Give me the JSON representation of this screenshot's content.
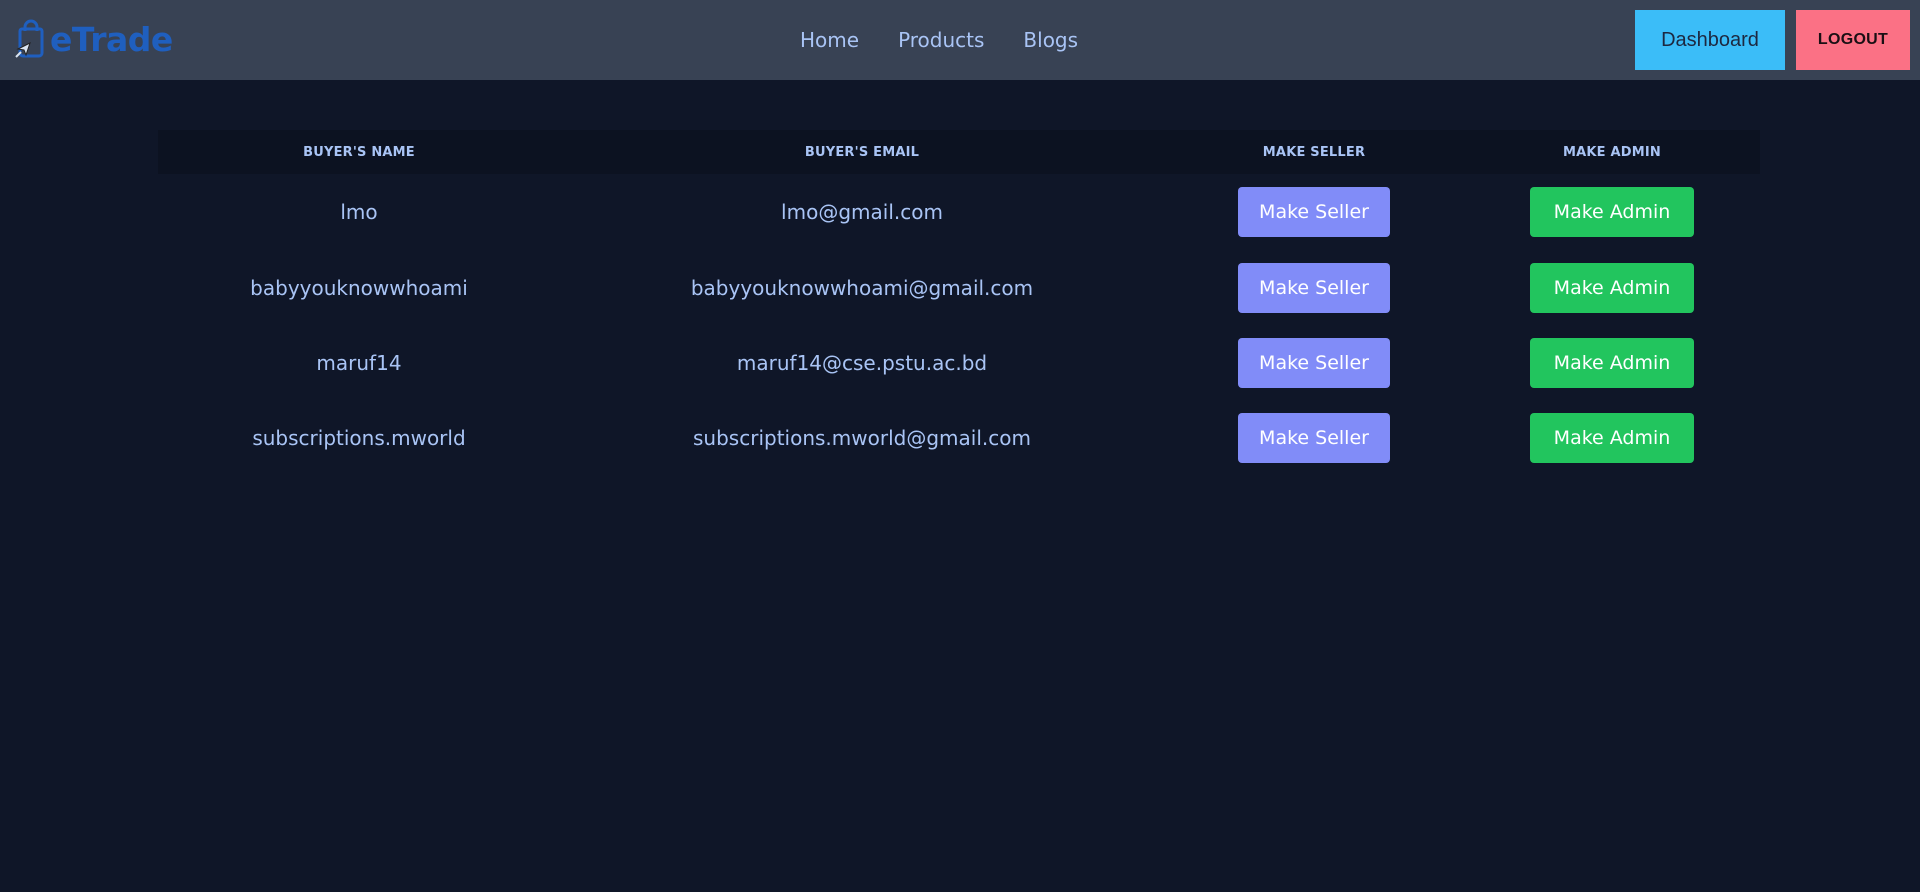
{
  "nav": {
    "brand": "eTrade",
    "links": [
      "Home",
      "Products",
      "Blogs"
    ],
    "dashboard_label": "Dashboard",
    "logout_label": "LOGOUT"
  },
  "table": {
    "headers": {
      "name": "BUYER'S NAME",
      "email": "BUYER'S EMAIL",
      "seller": "MAKE SELLER",
      "admin": "MAKE ADMIN"
    },
    "rows": [
      {
        "name": "lmo",
        "email": "lmo@gmail.com",
        "seller_label": "Make Seller",
        "admin_label": "Make Admin"
      },
      {
        "name": "babyyouknowwhoami",
        "email": "babyyouknowwhoami@gmail.com",
        "seller_label": "Make Seller",
        "admin_label": "Make Admin"
      },
      {
        "name": "maruf14",
        "email": "maruf14@cse.pstu.ac.bd",
        "seller_label": "Make Seller",
        "admin_label": "Make Admin"
      },
      {
        "name": "subscriptions.mworld",
        "email": "subscriptions.mworld@gmail.com",
        "seller_label": "Make Seller",
        "admin_label": "Make Admin"
      }
    ]
  },
  "colors": {
    "navbar": "#384254",
    "background": "#0f1628",
    "dashboard": "#3bbdf8",
    "logout": "#fb7185",
    "seller": "#818cf8",
    "admin": "#22c55e"
  },
  "icons": {
    "brand": "shopping-bag-icon",
    "cursor": "cursor-arrow-icon"
  }
}
